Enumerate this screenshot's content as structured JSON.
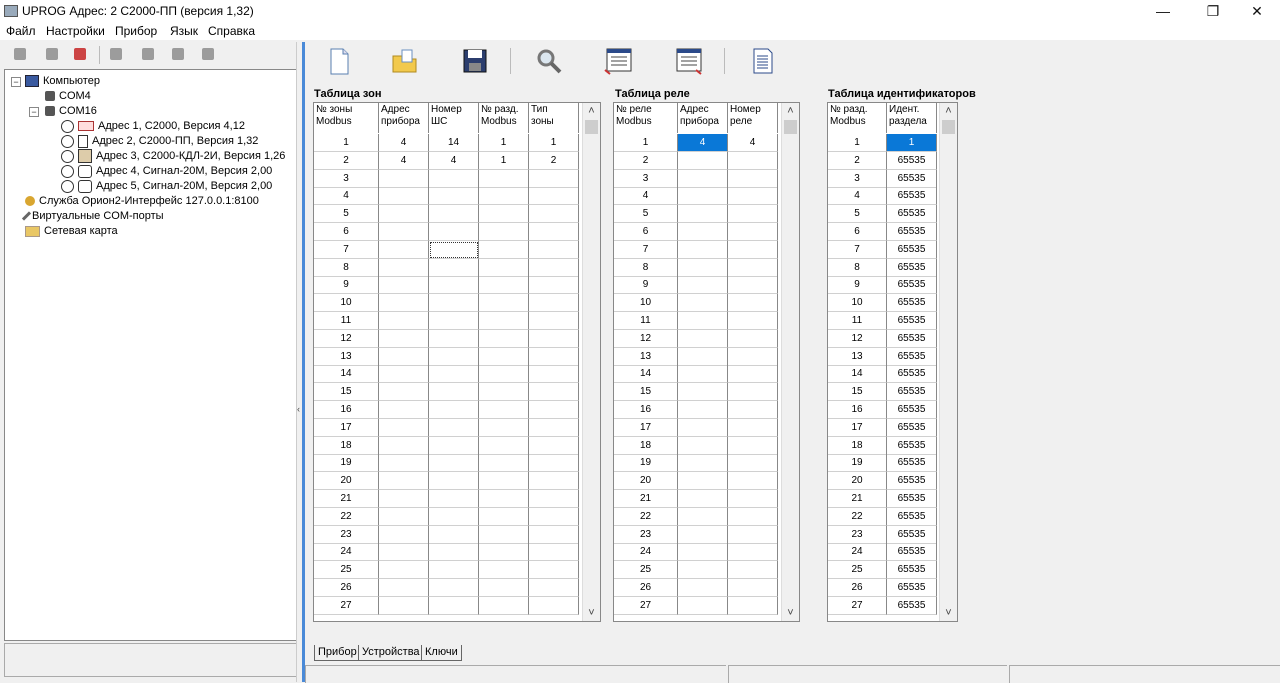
{
  "window": {
    "title": "UPROG  Адрес:  2  С2000-ПП (версия  1,32)"
  },
  "menu": [
    "Файл",
    "Настройки",
    "Прибор",
    "Язык",
    "Справка"
  ],
  "tree": {
    "computer": "Компьютер",
    "com4": "COM4",
    "com16": "COM16",
    "devices": [
      "Адрес 1, С2000, Версия 4,12",
      "Адрес 2, С2000-ПП, Версия 1,32",
      "Адрес 3, С2000-КДЛ-2И, Версия 1,26",
      "Адрес 4, Сигнал-20М, Версия 2,00",
      "Адрес 5, Сигнал-20М, Версия 2,00"
    ],
    "orion": "Служба Орион2-Интерфейс 127.0.0.1:8100",
    "virtual": "Виртуальные COM-порты",
    "network": "Сетевая карта"
  },
  "zones": {
    "title": "Таблица зон",
    "headers": [
      [
        "№ зоны",
        "Modbus"
      ],
      [
        "Адрес",
        "прибора"
      ],
      [
        "Номер",
        "ШС"
      ],
      [
        "№ разд.",
        "Modbus"
      ],
      [
        "Тип",
        "зоны"
      ]
    ],
    "rows": [
      [
        "1",
        "4",
        "14",
        "1",
        "1"
      ],
      [
        "2",
        "4",
        "4",
        "1",
        "2"
      ],
      [
        "3",
        "",
        "",
        "",
        ""
      ],
      [
        "4",
        "",
        "",
        "",
        ""
      ],
      [
        "5",
        "",
        "",
        "",
        ""
      ],
      [
        "6",
        "",
        "",
        "",
        ""
      ],
      [
        "7",
        "",
        "",
        "",
        ""
      ],
      [
        "8",
        "",
        "",
        "",
        ""
      ],
      [
        "9",
        "",
        "",
        "",
        ""
      ],
      [
        "10",
        "",
        "",
        "",
        ""
      ],
      [
        "11",
        "",
        "",
        "",
        ""
      ],
      [
        "12",
        "",
        "",
        "",
        ""
      ],
      [
        "13",
        "",
        "",
        "",
        ""
      ],
      [
        "14",
        "",
        "",
        "",
        ""
      ],
      [
        "15",
        "",
        "",
        "",
        ""
      ],
      [
        "16",
        "",
        "",
        "",
        ""
      ],
      [
        "17",
        "",
        "",
        "",
        ""
      ],
      [
        "18",
        "",
        "",
        "",
        ""
      ],
      [
        "19",
        "",
        "",
        "",
        ""
      ],
      [
        "20",
        "",
        "",
        "",
        ""
      ],
      [
        "21",
        "",
        "",
        "",
        ""
      ],
      [
        "22",
        "",
        "",
        "",
        ""
      ],
      [
        "23",
        "",
        "",
        "",
        ""
      ],
      [
        "24",
        "",
        "",
        "",
        ""
      ],
      [
        "25",
        "",
        "",
        "",
        ""
      ],
      [
        "26",
        "",
        "",
        "",
        ""
      ],
      [
        "27",
        "",
        "",
        "",
        ""
      ]
    ]
  },
  "relays": {
    "title": "Таблица реле",
    "headers": [
      [
        "№ реле",
        "Modbus"
      ],
      [
        "Адрес",
        "прибора"
      ],
      [
        "Номер",
        "реле"
      ]
    ],
    "rows": [
      [
        "1",
        "4",
        "4"
      ],
      [
        "2",
        "",
        ""
      ],
      [
        "3",
        "",
        ""
      ],
      [
        "4",
        "",
        ""
      ],
      [
        "5",
        "",
        ""
      ],
      [
        "6",
        "",
        ""
      ],
      [
        "7",
        "",
        ""
      ],
      [
        "8",
        "",
        ""
      ],
      [
        "9",
        "",
        ""
      ],
      [
        "10",
        "",
        ""
      ],
      [
        "11",
        "",
        ""
      ],
      [
        "12",
        "",
        ""
      ],
      [
        "13",
        "",
        ""
      ],
      [
        "14",
        "",
        ""
      ],
      [
        "15",
        "",
        ""
      ],
      [
        "16",
        "",
        ""
      ],
      [
        "17",
        "",
        ""
      ],
      [
        "18",
        "",
        ""
      ],
      [
        "19",
        "",
        ""
      ],
      [
        "20",
        "",
        ""
      ],
      [
        "21",
        "",
        ""
      ],
      [
        "22",
        "",
        ""
      ],
      [
        "23",
        "",
        ""
      ],
      [
        "24",
        "",
        ""
      ],
      [
        "25",
        "",
        ""
      ],
      [
        "26",
        "",
        ""
      ],
      [
        "27",
        "",
        ""
      ]
    ]
  },
  "ids": {
    "title": "Таблица идентификаторов",
    "headers": [
      [
        "№ разд.",
        "Modbus"
      ],
      [
        "Идент.",
        "раздела"
      ]
    ],
    "rows": [
      [
        "1",
        "1"
      ],
      [
        "2",
        "65535"
      ],
      [
        "3",
        "65535"
      ],
      [
        "4",
        "65535"
      ],
      [
        "5",
        "65535"
      ],
      [
        "6",
        "65535"
      ],
      [
        "7",
        "65535"
      ],
      [
        "8",
        "65535"
      ],
      [
        "9",
        "65535"
      ],
      [
        "10",
        "65535"
      ],
      [
        "11",
        "65535"
      ],
      [
        "12",
        "65535"
      ],
      [
        "13",
        "65535"
      ],
      [
        "14",
        "65535"
      ],
      [
        "15",
        "65535"
      ],
      [
        "16",
        "65535"
      ],
      [
        "17",
        "65535"
      ],
      [
        "18",
        "65535"
      ],
      [
        "19",
        "65535"
      ],
      [
        "20",
        "65535"
      ],
      [
        "21",
        "65535"
      ],
      [
        "22",
        "65535"
      ],
      [
        "23",
        "65535"
      ],
      [
        "24",
        "65535"
      ],
      [
        "25",
        "65535"
      ],
      [
        "26",
        "65535"
      ],
      [
        "27",
        "65535"
      ]
    ]
  },
  "tabs": [
    "Прибор",
    "Устройства",
    "Ключи"
  ],
  "icons": {
    "toolbar": [
      "new-file-icon",
      "open-folder-icon",
      "save-disk-icon",
      "search-icon",
      "read-config-icon",
      "write-config-icon",
      "report-icon"
    ]
  }
}
